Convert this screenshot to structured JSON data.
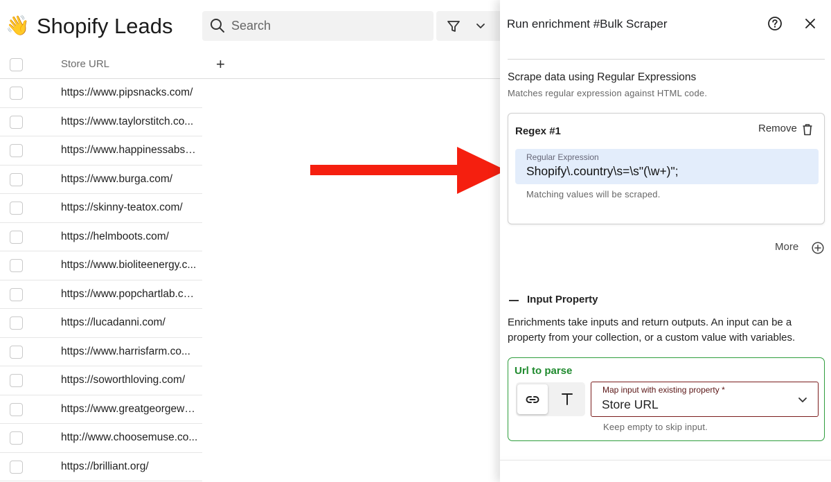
{
  "app": {
    "title": "Shopify Leads",
    "emoji": "👋",
    "search_placeholder": "Search"
  },
  "table": {
    "column_label": "Store URL",
    "add_column_label": "+",
    "rows": [
      "https://www.pipsnacks.com/",
      "https://www.taylorstitch.co...",
      "https://www.happinessabsc...",
      "https://www.burga.com/",
      "https://skinny-teatox.com/",
      "https://helmboots.com/",
      "https://www.bioliteenergy.c...",
      "https://www.popchartlab.co...",
      "https://lucadanni.com/",
      "https://www.harrisfarm.co...",
      "https://soworthloving.com/",
      "https://www.greatgeorgewa...",
      "http://www.choosemuse.co...",
      "https://brilliant.org/"
    ]
  },
  "panel": {
    "title": "Run enrichment #Bulk Scraper",
    "section_title": "Scrape data using Regular Expressions",
    "section_desc": "Matches regular expression against HTML code.",
    "regex": {
      "title": "Regex #1",
      "remove_label": "Remove",
      "field_label": "Regular Expression",
      "field_value": "Shopify\\.country\\s=\\s\"(\\w+)\";",
      "help": "Matching values will be scraped."
    },
    "more_label": "More",
    "input_property": {
      "title": "Input Property",
      "desc": "Enrichments take inputs and return outputs. An input can be a property from your collection, or a custom value with variables.",
      "card_title": "Url to parse",
      "select_label": "Map input with existing property *",
      "select_value": "Store URL",
      "select_help": "Keep empty to skip input."
    }
  },
  "colors": {
    "arrow": "#f51f0f",
    "accent_green": "#2e9d3c",
    "field_highlight": "#e3edfb",
    "select_border": "#7a1c1c"
  }
}
